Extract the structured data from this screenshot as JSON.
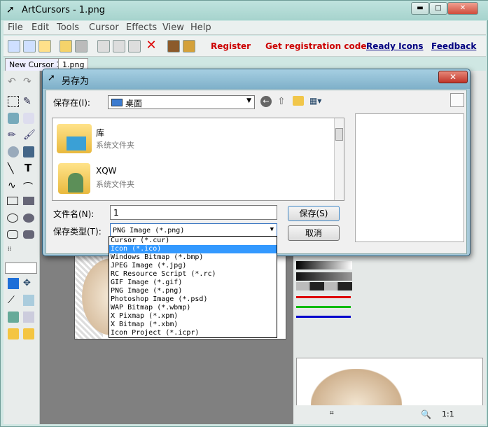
{
  "app": {
    "title": "ArtCursors - 1.png",
    "min_icon": "min-icon",
    "max_icon": "max-icon",
    "close_icon": "close-icon"
  },
  "menu": [
    "File",
    "Edit",
    "Tools",
    "Cursor",
    "Effects",
    "View",
    "Help"
  ],
  "toolbar_links": {
    "register": "Register",
    "get_code": "Get registration code",
    "ready_icons": "Ready Icons",
    "feedback": "Feedback"
  },
  "colors": {
    "register": "#cc0000",
    "link": "#000080",
    "selection": "#3399ff"
  },
  "tabs": [
    "New Cursor 1",
    "1.png"
  ],
  "dialog": {
    "title": "另存为",
    "lookin_label": "保存在(I):",
    "lookin_value": "桌面",
    "files": [
      {
        "name": "库",
        "type": "系统文件夹"
      },
      {
        "name": "XQW",
        "type": "系统文件夹"
      }
    ],
    "filename_label": "文件名(N):",
    "filename_value": "1",
    "filetype_label": "保存类型(T):",
    "filetype_value": "PNG Image (*.png)",
    "save_button": "保存(S)",
    "cancel_button": "取消",
    "options": [
      "Cursor (*.cur)",
      "Icon (*.ico)",
      "Windows Bitmap (*.bmp)",
      "JPEG Image (*.jpg)",
      "RC Resource Script (*.rc)",
      "GIF Image (*.gif)",
      "PNG Image (*.png)",
      "Photoshop Image (*.psd)",
      "WAP Bitmap (*.wbmp)",
      "X Pixmap (*.xpm)",
      "X Bitmap (*.xbm)",
      "Icon Project (*.icpr)"
    ],
    "selected_option": "Icon (*.ico)"
  },
  "status": {
    "zoom": "1:1"
  }
}
